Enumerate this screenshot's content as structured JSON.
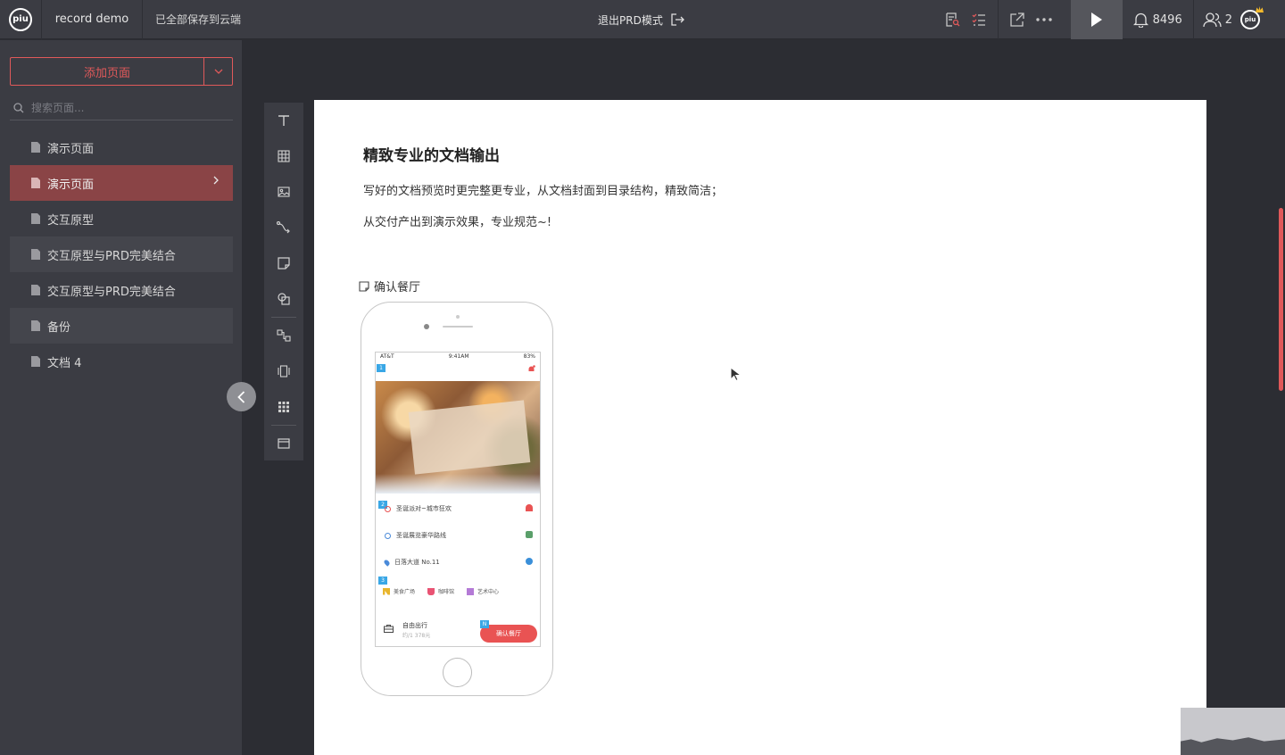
{
  "app": {
    "logo_text": "piu",
    "project_name": "record demo",
    "save_status": "已全部保存到云端",
    "exit_prd_label": "退出PRD模式",
    "notification_count": "8496",
    "user_count": "2",
    "avatar_text": "piu"
  },
  "sidebar": {
    "add_page_label": "添加页面",
    "search_placeholder": "搜索页面...",
    "pages": [
      {
        "label": "演示页面",
        "state": "normal"
      },
      {
        "label": "演示页面",
        "state": "active"
      },
      {
        "label": "交互原型",
        "state": "normal"
      },
      {
        "label": "交互原型与PRD完美结合",
        "state": "alt"
      },
      {
        "label": "交互原型与PRD完美结合",
        "state": "normal"
      },
      {
        "label": "备份",
        "state": "alt"
      },
      {
        "label": "文档 4",
        "state": "normal"
      }
    ]
  },
  "toolbar": {
    "tools": [
      "text-tool-icon",
      "table-tool-icon",
      "image-tool-icon",
      "connector-tool-icon",
      "note-tool-icon",
      "shape-tool-icon",
      "flow-tool-icon",
      "component-tool-icon",
      "grid-tool-icon",
      "frame-tool-icon"
    ]
  },
  "document": {
    "title": "精致专业的文档输出",
    "paragraph1": "写好的文档预览时更完整更专业，从文档封面到目录结构，精致简洁；",
    "paragraph2": "从交付产出到演示效果，专业规范~!",
    "prototype_caption": "确认餐厅"
  },
  "phone": {
    "carrier": "AT&T",
    "time": "9:41AM",
    "battery": "83%",
    "badges": [
      "1",
      "2",
      "3",
      "N"
    ],
    "rows": [
      {
        "label": "圣诞派对~城市狂欢"
      },
      {
        "label": "圣诞展览豪华路线"
      },
      {
        "label": "日落大道 No.11"
      }
    ],
    "categories": [
      "美食广场",
      "咖啡馆",
      "艺术中心"
    ],
    "bottom_title": "自由出行",
    "bottom_subtitle": "约/1 378元",
    "confirm_label": "确认餐厅"
  },
  "colors": {
    "accent": "#e0595a",
    "active_item": "#8a4446",
    "topbar": "#3b3c43",
    "canvas": "#2c2d33"
  }
}
